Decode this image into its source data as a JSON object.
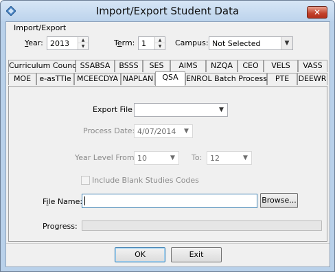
{
  "window": {
    "title": "Import/Export Student Data",
    "close_glyph": "✕"
  },
  "import_export": {
    "group_label": "Import/Export",
    "year": {
      "label_accel": "Y",
      "label_rest": "ear:",
      "value": "2013"
    },
    "term": {
      "label_pre": "T",
      "label_accel": "e",
      "label_rest": "rm:",
      "value": "1"
    },
    "campus": {
      "label": "Campus:",
      "value": "Not Selected"
    }
  },
  "tabs": {
    "row1": [
      "Curriculum Council",
      "SSABSA",
      "BSSS",
      "SES",
      "AIMS",
      "NZQA",
      "CEO",
      "VELS",
      "VASS"
    ],
    "row2": [
      "MOE",
      "e-asTTle",
      "MCEECDYA",
      "NAPLAN",
      "QSA",
      "ENROL Batch Process",
      "PTE",
      "DEEWR"
    ],
    "active": "QSA"
  },
  "qsa": {
    "export_file_label": "Export File",
    "export_file_value": "",
    "process_date_label": "Process Date:",
    "process_date_value": "4/07/2014",
    "year_level_from_label": "Year Level From:",
    "year_level_from_value": "10",
    "to_label": "To:",
    "to_value": "12",
    "include_blank_label": "Include Blank Studies Codes",
    "include_blank_checked": false,
    "file_name_label_pre": "F",
    "file_name_label_accel": "i",
    "file_name_label_rest": "le Name:",
    "file_name_value": "",
    "browse_label": "Browse...",
    "progress_label": "Progress:",
    "progress_fraction": 0
  },
  "buttons": {
    "ok_label": "OK",
    "exit_label": "Exit"
  },
  "icons": {
    "app": "app-diamond-icon",
    "close": "close-icon",
    "spin_up": "▲",
    "spin_down": "▼",
    "dropdown": "▼"
  },
  "colors": {
    "title_bar": "#c4d8ee",
    "close_button": "#c2402a",
    "focus_border": "#3c7fb1"
  }
}
